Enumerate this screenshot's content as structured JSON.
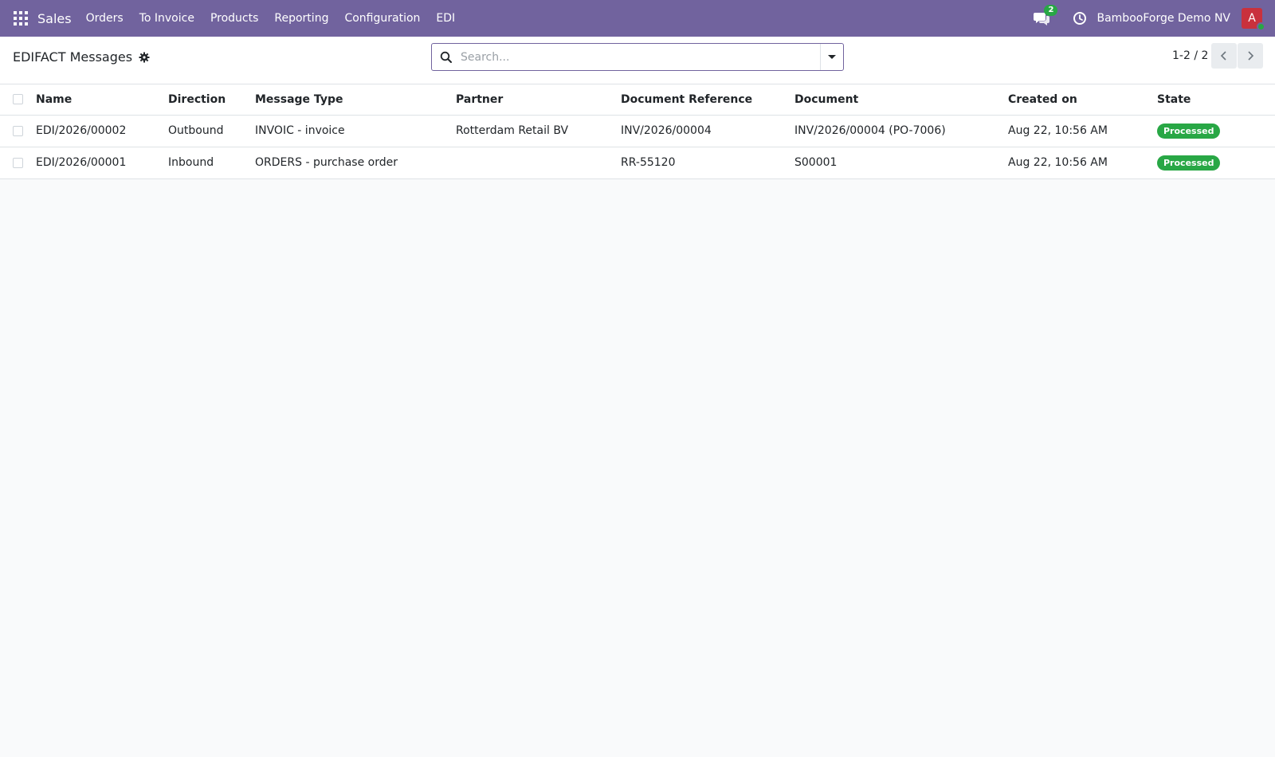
{
  "navbar": {
    "app_name": "Sales",
    "menu": [
      "Orders",
      "To Invoice",
      "Products",
      "Reporting",
      "Configuration",
      "EDI"
    ],
    "chat_count": "2",
    "company": "BambooForge Demo NV",
    "avatar_initial": "A"
  },
  "control_panel": {
    "title": "EDIFACT Messages",
    "search_placeholder": "Search...",
    "pager": "1-2 / 2"
  },
  "table": {
    "columns": [
      "Name",
      "Direction",
      "Message Type",
      "Partner",
      "Document Reference",
      "Document",
      "Created on",
      "State"
    ],
    "rows": [
      {
        "name": "EDI/2026/00002",
        "direction": "Outbound",
        "message_type": "INVOIC - invoice",
        "partner": "Rotterdam Retail BV",
        "document_reference": "INV/2026/00004",
        "document": "INV/2026/00004 (PO-7006)",
        "created_on": "Aug 22, 10:56 AM",
        "state": "Processed"
      },
      {
        "name": "EDI/2026/00001",
        "direction": "Inbound",
        "message_type": "ORDERS - purchase order",
        "partner": "",
        "document_reference": "RR-55120",
        "document": "S00001",
        "created_on": "Aug 22, 10:56 AM",
        "state": "Processed"
      }
    ]
  },
  "colors": {
    "navbar": "#71639e",
    "state_processed": "#28a745",
    "avatar": "#c9313d"
  }
}
